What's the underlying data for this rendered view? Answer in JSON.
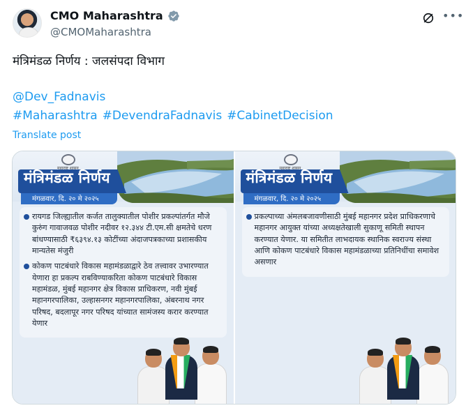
{
  "author": {
    "display_name": "CMO Maharashtra",
    "handle": "@CMOMaharashtra",
    "verified_icon": "verified-badge-icon"
  },
  "post": {
    "text": "मंत्रिमंडळ निर्णय : जलसंपदा विभाग",
    "mention": "@Dev_Fadnavis",
    "hashtags": [
      "#Maharashtra",
      "#DevendraFadnavis",
      "#CabinetDecision"
    ],
    "translate_label": "Translate post"
  },
  "cards": [
    {
      "seal_caption": "महाराष्ट्र शासन",
      "title": "मंत्रिमंडळ निर्णय",
      "date": "मंगळवार, दि. २० मे २०२५",
      "bullets": [
        "रायगड जिल्ह्यातील कर्जत तालुक्यातील पोशीर प्रकल्पांतर्गत मौजे कुरुंग गावाजवळ पोशीर नदीवर १२.३४४ टी.एम.सी क्षमतेचे धरण बांधण्यासाठी ₹६३९४.१३ कोटींच्या अंदाजपत्रकाच्या प्रशासकीय मान्यतेस मंजुरी",
        "कोकण पाटबंधारे विकास महामंडळाद्वारे ठेव तत्त्वावर उभारण्यात येणारा हा प्रकल्प राबविण्याकरिता कोकण पाटबंधारे विकास महामंडळ, मुंबई महानगर क्षेत्र विकास प्राधिकरण, नवी मुंबई महानगरपालिका, उल्हासनगर महानगरपालिका, अंबरनाथ नगर परिषद, बदलापूर नगर परिषद यांच्यात सामंजस्य करार करण्यात येणार"
      ]
    },
    {
      "seal_caption": "महाराष्ट्र शासन",
      "title": "मंत्रिमंडळ निर्णय",
      "date": "मंगळवार, दि. २० मे २०२५",
      "bullets": [
        "प्रकल्पाच्या अंमलबजावणीसाठी मुंबई महानगर प्रदेश प्राधिकरणाचे महानगर आयुक्त यांच्या अध्यक्षतेखाली सुकाणू समिती स्थापन करण्यात येणार. या समितीत लाभदायक स्थानिक स्वराज्य संस्था आणि कोकण पाटबंधारे विकास महामंडळाच्या प्रतिनिधींचा समावेश असणार"
      ]
    }
  ],
  "icons": {
    "grok": "grok-icon",
    "more": "more-options-icon"
  },
  "colors": {
    "link": "#1d9bf0",
    "banner": "#1f4f9c",
    "verified": "#829aab"
  }
}
